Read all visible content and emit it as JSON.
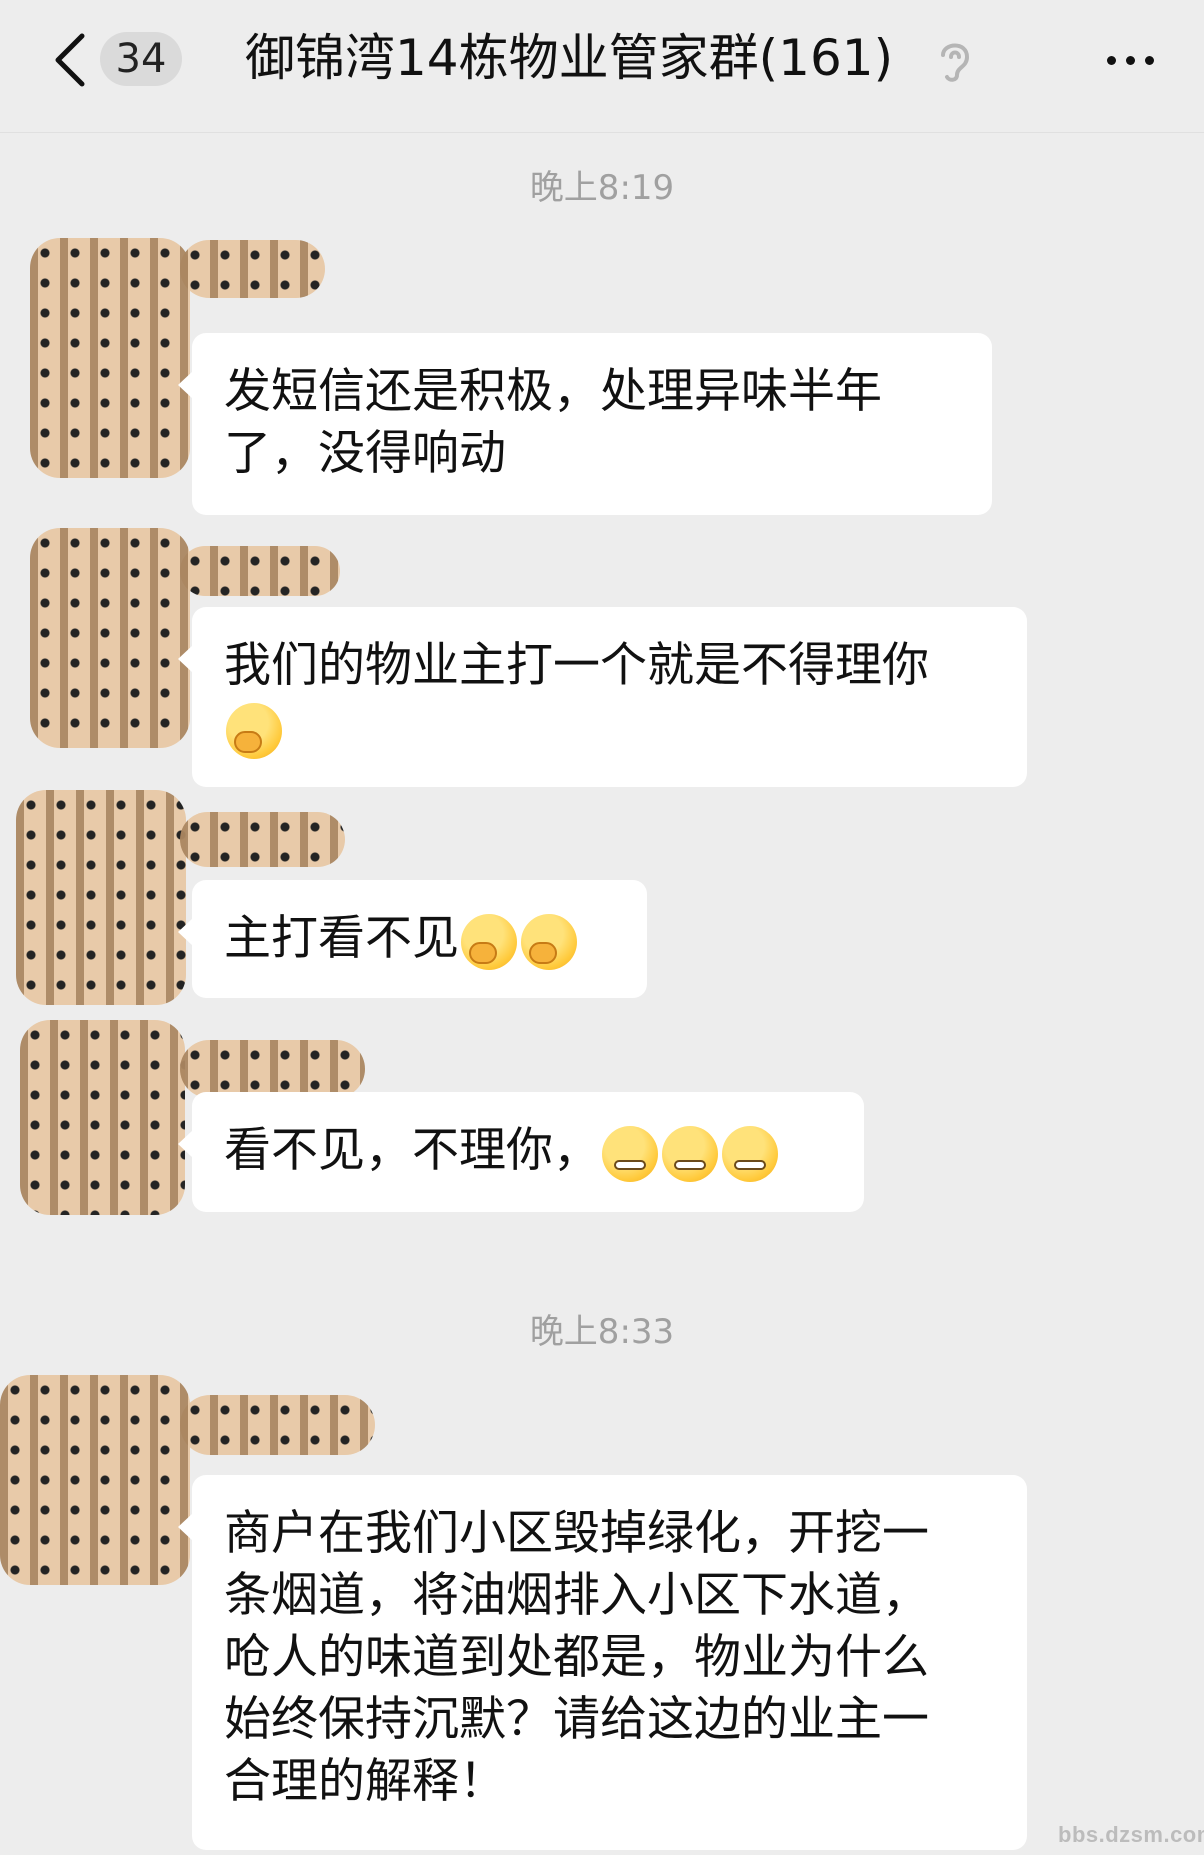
{
  "header": {
    "back_icon": "chevron-left-icon",
    "unread_count": "34",
    "title": "御锦湾14栋物业管家群(161)",
    "mute_icon": "ear-icon",
    "more_icon": "more-horizontal-icon"
  },
  "timestamps": [
    "晚上8:19",
    "晚上8:33"
  ],
  "messages": [
    {
      "text": "发短信还是积极，处理异味半年\n了，没得响动",
      "emoji": []
    },
    {
      "text": "我们的物业主打一个就是不得理你\n",
      "emoji": [
        "face-with-hand-over-mouth"
      ]
    },
    {
      "text": "主打看不见",
      "emoji": [
        "face-with-hand-over-mouth",
        "face-with-hand-over-mouth"
      ]
    },
    {
      "text": "看不见，不理你，",
      "emoji": [
        "grinning-face",
        "grinning-face",
        "grinning-face"
      ]
    },
    {
      "text": "商户在我们小区毁掉绿化，开挖一\n条烟道，将油烟排入小区下水道，\n呛人的味道到处都是，物业为什么\n始终保持沉默？请给这边的业主一\n合理的解释！",
      "emoji": []
    }
  ],
  "watermark": "bbs.dzsm.com"
}
